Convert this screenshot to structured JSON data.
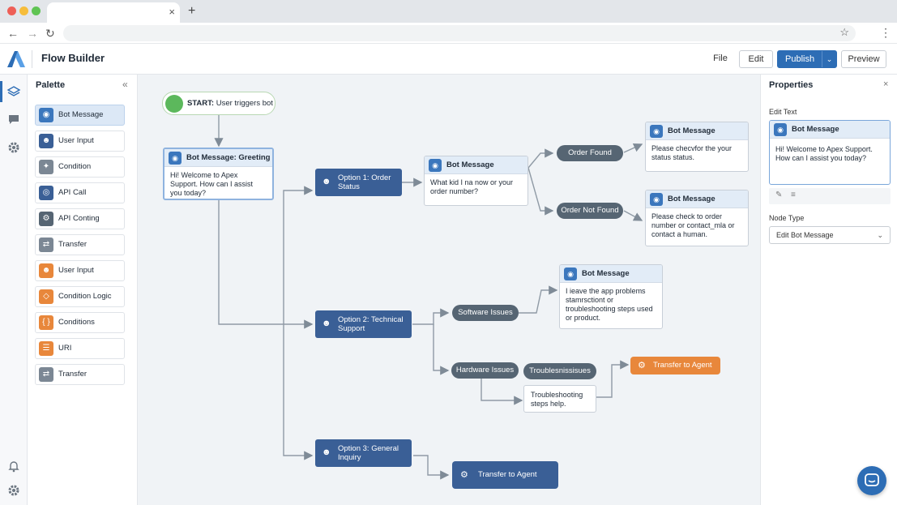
{
  "browser": {
    "tab_close": "×",
    "new_tab": "+",
    "back": "←",
    "forward": "→",
    "reload": "↻",
    "bookmark": "☆",
    "menu": "⋮"
  },
  "header": {
    "app_title": "Flow Builder",
    "file_label": "File",
    "edit_label": "Edit",
    "publish_label": "Publish",
    "preview_label": "Preview",
    "brand_color": "#2d6db5"
  },
  "palette": {
    "title": "Palette",
    "collapse": "«",
    "items": [
      {
        "label": "Bot Message",
        "icon": "robot-icon",
        "color": "#3b77bd",
        "active": true
      },
      {
        "label": "User Input",
        "icon": "user-icon",
        "color": "#3a5f96"
      },
      {
        "label": "Condition",
        "icon": "condition-icon",
        "color": "#7b8794"
      },
      {
        "label": "API Call",
        "icon": "globe-icon",
        "color": "#3a5f96"
      },
      {
        "label": "API Conting",
        "icon": "gear-icon",
        "color": "#566573"
      },
      {
        "label": "Transfer",
        "icon": "transfer-icon",
        "color": "#7b8794"
      },
      {
        "label": "User Input",
        "icon": "user-icon",
        "color": "#e8873b"
      },
      {
        "label": "Condition Logic",
        "icon": "diamond-icon",
        "color": "#e8873b"
      },
      {
        "label": "Conditions",
        "icon": "braces-icon",
        "color": "#e8873b"
      },
      {
        "label": "URI",
        "icon": "list-icon",
        "color": "#e8873b"
      },
      {
        "label": "Transfer",
        "icon": "transfer-icon",
        "color": "#7b8794"
      }
    ]
  },
  "flow": {
    "start_prefix": "START:",
    "start_text": "User triggers bot",
    "greeting_title": "Bot Message: Greeting",
    "greeting_body": "Hi! Welcome to Apex Support. How can I assist you today?",
    "option1": "Option 1: Order Status",
    "option2": "Option 2: Technical Support",
    "option3": "Option 3: General Inquiry",
    "bot_message": "Bot Message",
    "order_question": "What kid I na now or your order number?",
    "order_found": "Order Found",
    "order_not_found": "Order Not Found",
    "found_msg": "Please checvfor the your status status.",
    "not_found_msg": "Please check to order number or contact_mla or contact a human.",
    "software_issues": "Software Issues",
    "hardware_issues": "Hardware Issues",
    "troubleshoot_pill": "Troublesnissisues",
    "app_problems_msg": "I ieave the app problems stamrsctiont or troubleshooting steps used or product.",
    "troubleshoot_steps": "Troubleshooting steps help.",
    "transfer_agent": "Transfer to Agent",
    "transfer_agent2": "Transfer to Agent"
  },
  "properties": {
    "title": "Properties",
    "close": "×",
    "edit_text_label": "Edit Text",
    "card_title": "Bot Message",
    "card_body": "Hi! Welcome to Apex Support. How can I assist you today?",
    "node_type_label": "Node Type",
    "node_type_value": "Edit Bot Message"
  }
}
